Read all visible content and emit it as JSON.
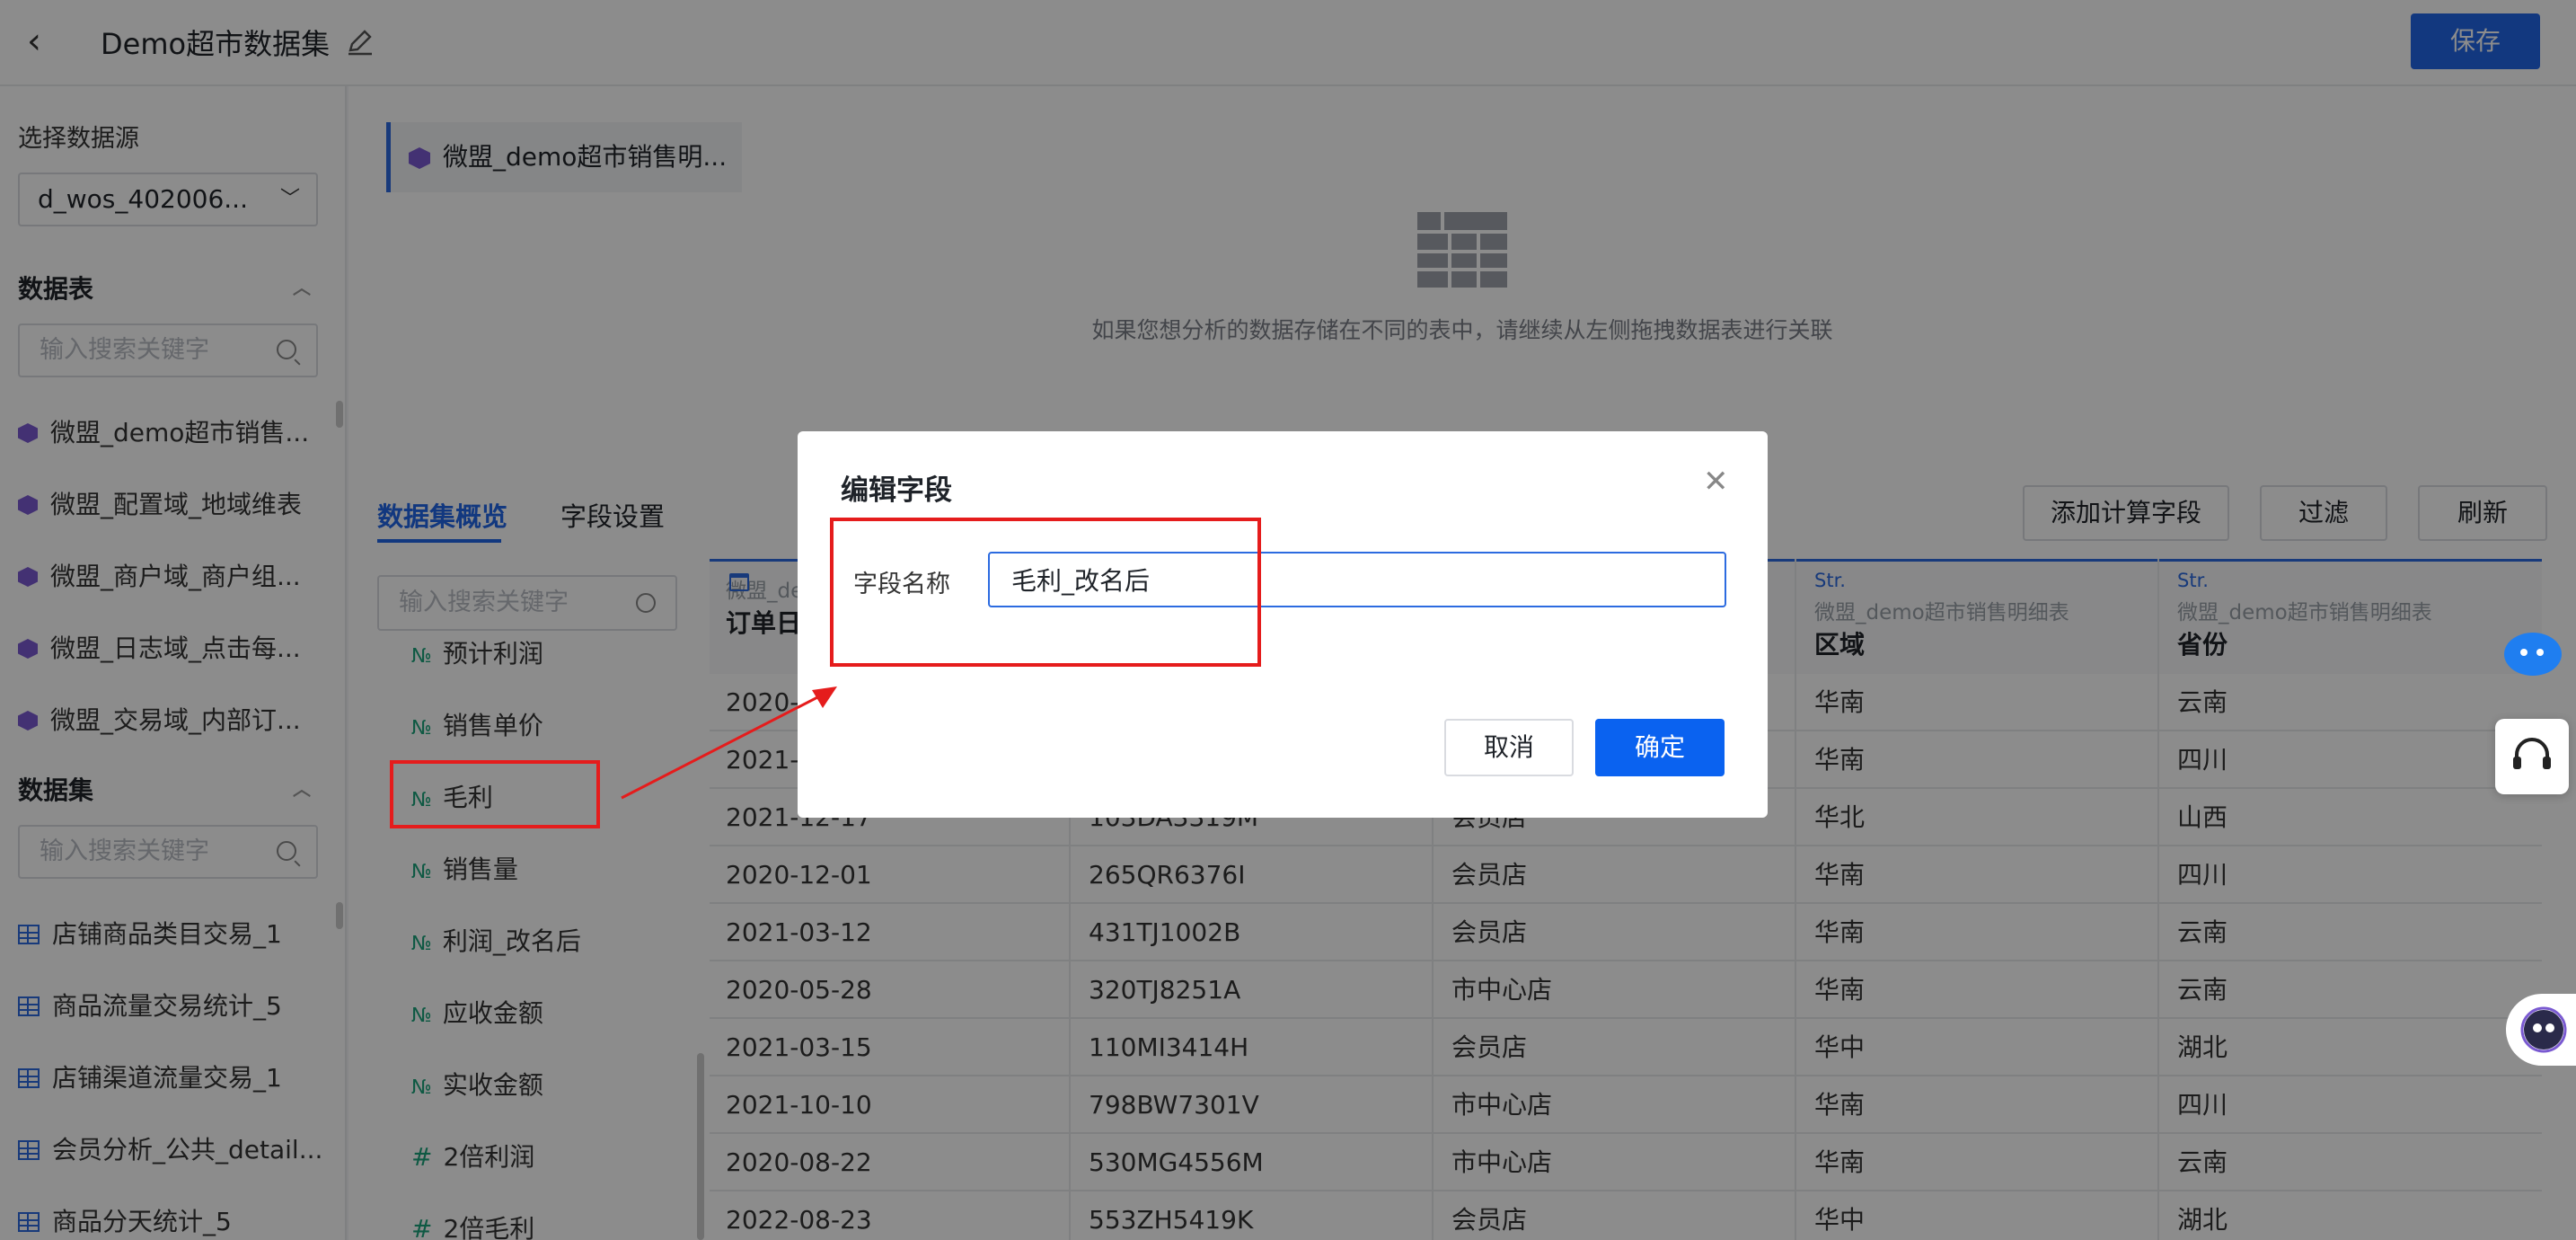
{
  "header": {
    "title": "Demo超市数据集",
    "save_label": "保存"
  },
  "sidebar": {
    "datasource_label": "选择数据源",
    "datasource_value": "d_wos_402006...",
    "tables_section": "数据表",
    "tables_search_placeholder": "输入搜索关键字",
    "tables": [
      "微盟_demo超市销售...",
      "微盟_配置域_地域维表",
      "微盟_商户域_商户组...",
      "微盟_日志域_点击每...",
      "微盟_交易域_内部订..."
    ],
    "datasets_section": "数据集",
    "datasets_search_placeholder": "输入搜索关键字",
    "datasets": [
      "店铺商品类目交易_1",
      "商品流量交易统计_5",
      "店铺渠道流量交易_1",
      "会员分析_公共_detail...",
      "商品分天统计_5"
    ]
  },
  "canvas": {
    "table_chip": "微盟_demo超市销售明...",
    "empty_hint": "如果您想分析的数据存储在不同的表中，请继续从左侧拖拽数据表进行关联"
  },
  "tabs": {
    "overview": "数据集概览",
    "field_settings": "字段设置"
  },
  "actions": {
    "add_calc": "添加计算字段",
    "filter": "过滤",
    "refresh": "刷新"
  },
  "fields": {
    "search_placeholder": "输入搜索关键字",
    "items": [
      {
        "icon": "№",
        "name": "预计利润"
      },
      {
        "icon": "№",
        "name": "销售单价"
      },
      {
        "icon": "№",
        "name": "毛利"
      },
      {
        "icon": "№",
        "name": "销售量"
      },
      {
        "icon": "№",
        "name": "利润_改名后"
      },
      {
        "icon": "№",
        "name": "应收金额"
      },
      {
        "icon": "№",
        "name": "实收金额"
      },
      {
        "icon": "#",
        "name": "2倍利润"
      },
      {
        "icon": "#",
        "name": "2倍毛利"
      }
    ]
  },
  "grid": {
    "columns": [
      {
        "type": "",
        "source": "微盟_de",
        "name": "订单日"
      },
      {
        "type": "",
        "source": "",
        "name": ""
      },
      {
        "type": "",
        "source": "",
        "name": ""
      },
      {
        "type": "Str.",
        "source": "微盟_demo超市销售明细表",
        "name": "区域"
      },
      {
        "type": "Str.",
        "source": "微盟_demo超市销售明细表",
        "name": "省份"
      }
    ],
    "rows": [
      [
        "2020-",
        "",
        "",
        "华南",
        "云南"
      ],
      [
        "2021-",
        "",
        "",
        "华南",
        "四川"
      ],
      [
        "2021-12-17",
        "103DA3319M",
        "会员店",
        "华北",
        "山西"
      ],
      [
        "2020-12-01",
        "265QR6376I",
        "会员店",
        "华南",
        "四川"
      ],
      [
        "2021-03-12",
        "431TJ1002B",
        "会员店",
        "华南",
        "云南"
      ],
      [
        "2020-05-28",
        "320TJ8251A",
        "市中心店",
        "华南",
        "云南"
      ],
      [
        "2021-03-15",
        "110MI3414H",
        "会员店",
        "华中",
        "湖北"
      ],
      [
        "2021-10-10",
        "798BW7301V",
        "市中心店",
        "华南",
        "四川"
      ],
      [
        "2020-08-22",
        "530MG4556M",
        "市中心店",
        "华南",
        "云南"
      ],
      [
        "2022-08-23",
        "553ZH5419K",
        "会员店",
        "华中",
        "湖北"
      ]
    ]
  },
  "modal": {
    "title": "编辑字段",
    "field_label": "字段名称",
    "field_value": "毛利_改名后",
    "cancel_label": "取消",
    "ok_label": "确定"
  },
  "colors": {
    "primary": "#2166e8",
    "annotation": "#e51c1c"
  }
}
